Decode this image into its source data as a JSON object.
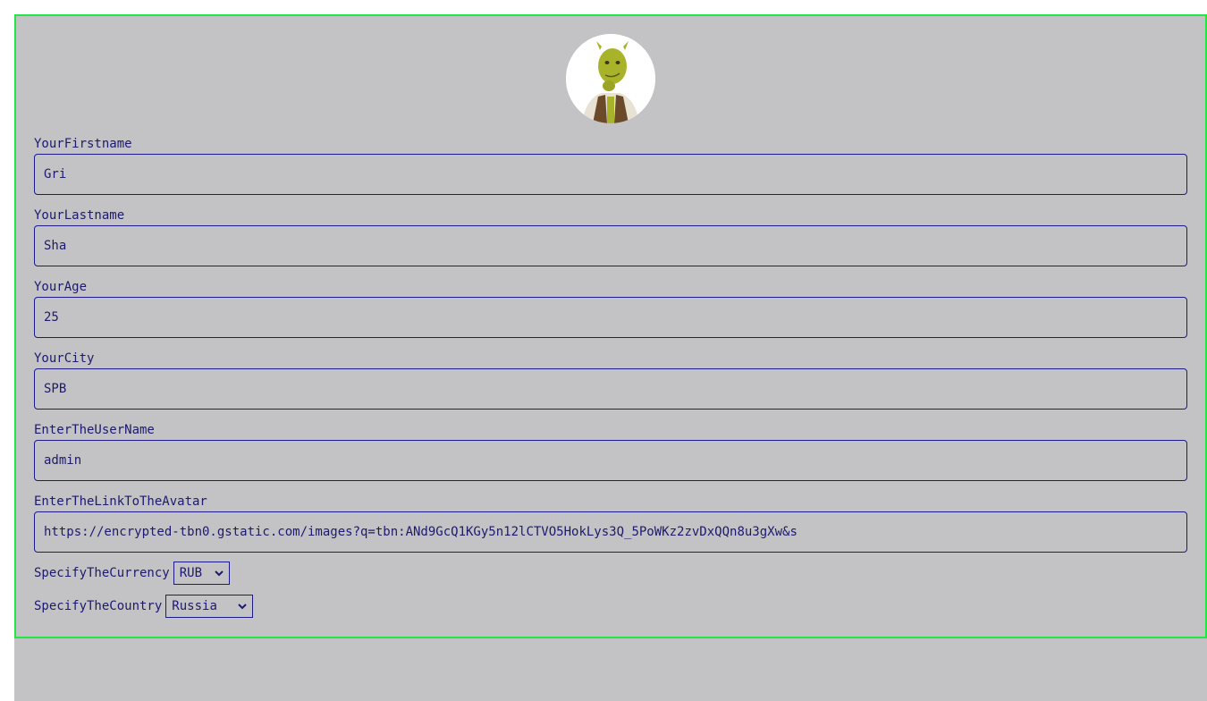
{
  "profile": {
    "avatar_alt": "shrek-avatar",
    "fields": [
      {
        "label": "YourFirstname",
        "value": "Gri"
      },
      {
        "label": "YourLastname",
        "value": "Sha"
      },
      {
        "label": "YourAge",
        "value": "25"
      },
      {
        "label": "YourCity",
        "value": "SPB"
      },
      {
        "label": "EnterTheUserName",
        "value": "admin"
      },
      {
        "label": "EnterTheLinkToTheAvatar",
        "value": "https://encrypted-tbn0.gstatic.com/images?q=tbn:ANd9GcQ1KGy5n12lCTVO5HokLys3Q_5PoWKz2zvDxQQn8u3gXw&s"
      }
    ],
    "currency": {
      "label": "SpecifyTheCurrency",
      "selected": "RUB"
    },
    "country": {
      "label": "SpecifyTheCountry",
      "selected": "Russia"
    }
  },
  "colors": {
    "background": "#c3c3c5",
    "panel_border": "#22e644",
    "text": "#1c1a6e",
    "input_border": "#1c1a8a"
  }
}
